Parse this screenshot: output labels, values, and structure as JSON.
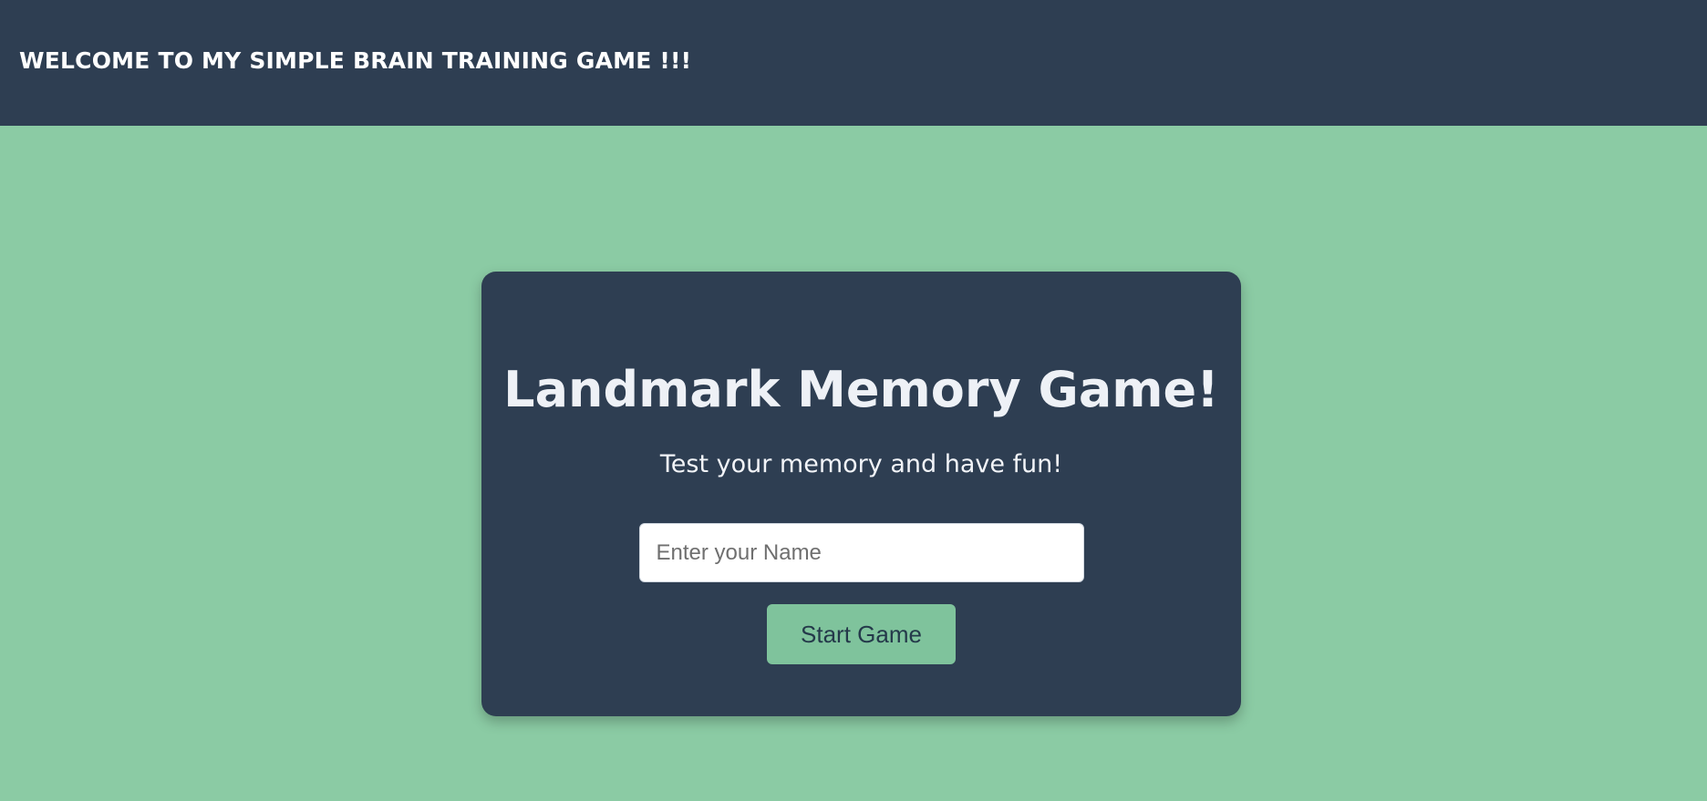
{
  "header": {
    "title": "WELCOME TO MY SIMPLE BRAIN TRAINING GAME !!!"
  },
  "card": {
    "title": "Landmark Memory Game!",
    "subtitle": "Test your memory and have fun!",
    "name_input": {
      "value": "",
      "placeholder": "Enter your Name"
    },
    "start_button_label": "Start Game"
  },
  "colors": {
    "page_background": "#8bcba4",
    "panel_background": "#2e3e52",
    "button_background": "#7fc39c",
    "button_text": "#24394a"
  }
}
